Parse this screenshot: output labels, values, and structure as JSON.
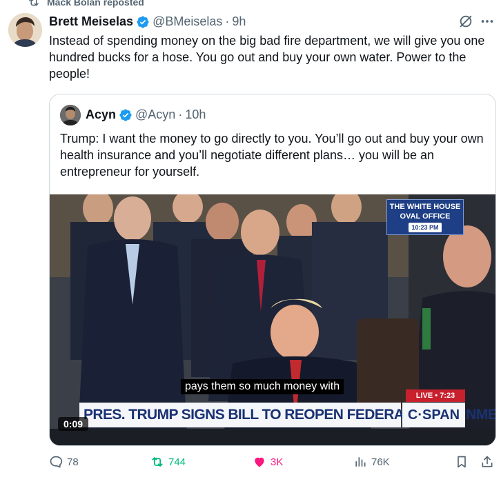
{
  "repost": {
    "label": "Mack Bolan reposted"
  },
  "tweet": {
    "name": "Brett Meiselas",
    "handle": "@BMeiselas",
    "separator": "·",
    "time": "9h",
    "text": "Instead of spending money on the big bad fire department, we will give you one hundred bucks for a hose. You go out and buy your own water. Power to the people!"
  },
  "quote": {
    "name": "Acyn",
    "handle": "@Acyn",
    "separator": "·",
    "time": "10h",
    "text": "Trump: I want the money to go directly to you. You’ll go out and buy your own health insurance and you’ll negotiate different plans… you will be an entrepreneur for yourself."
  },
  "video": {
    "badge_line1": "THE WHITE HOUSE",
    "badge_line2": "OVAL OFFICE",
    "badge_time": "10:23 PM",
    "caption": "pays them so much money with",
    "live": "LIVE • 7:23",
    "headline": "PRES. TRUMP SIGNS BILL TO REOPEN FEDERAL GOVERNMENT",
    "network": "C·SPAN",
    "duration": "0:09"
  },
  "actions": {
    "replies": "78",
    "reposts": "744",
    "likes": "3K",
    "views": "76K"
  },
  "colors": {
    "verified": "#1d9bf0",
    "repost_active": "#00ba7c",
    "like_active": "#f91880",
    "muted": "#536471",
    "cspan_blue": "#1a3272"
  },
  "icons": [
    "repost-icon",
    "verified-icon",
    "grok-icon",
    "more-icon",
    "reply-icon",
    "heart-icon",
    "views-icon",
    "bookmark-icon",
    "share-icon"
  ]
}
